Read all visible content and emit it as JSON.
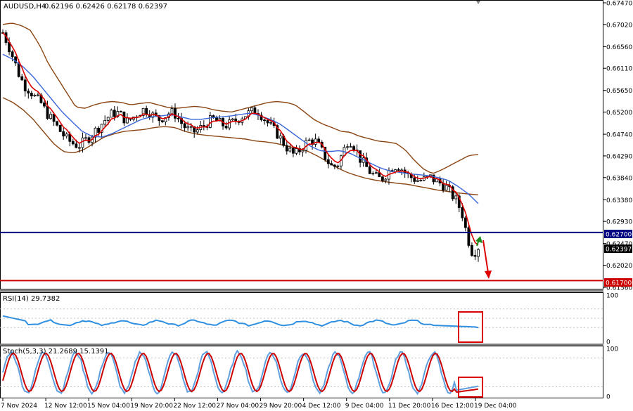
{
  "colors": {
    "background": "#ffffff",
    "frame": "#000000",
    "grid": "#c0c0c0",
    "bullish_candle": "#000000",
    "bearish_candle": "#000000",
    "bollinger": "#8b4513",
    "ma_fast": "#dd0000",
    "ma_slow": "#3a66d8",
    "rsi_line": "#2f8fe0",
    "stoch_main": "#5f9fe0",
    "stoch_signal": "#cc0000",
    "resistance_line": "#000080",
    "support_line": "#cc0000",
    "up_arrow": "#1b8a1b",
    "down_arrow": "#dd0000",
    "highlight_box": "#dd0000",
    "panel_separator": "#808080"
  },
  "header": {
    "title": "AUDUSD,H4",
    "ohlc": "0.62196 0.62426 0.62178 0.62397",
    "rsi_label": "RSI(14) 29.7382",
    "stoch_label": "Stoch(5,3,3) 21.2689 15.1391"
  },
  "levels": {
    "resistance": {
      "value": 0.627,
      "label": "0.62700"
    },
    "support": {
      "value": 0.617,
      "label": "0.61700"
    },
    "current": {
      "value": 0.62397,
      "label": "0.62397"
    }
  },
  "chart_data": {
    "type": "candlestick",
    "title": "AUDUSD,H4",
    "xlabel": "",
    "ylabel": "",
    "ylim": [
      0.6156,
      0.6747
    ],
    "y_ticks": [
      "0.67470",
      "0.67020",
      "0.66560",
      "0.66110",
      "0.65650",
      "0.65200",
      "0.64740",
      "0.64290",
      "0.63840",
      "0.63380",
      "0.62930",
      "0.62470",
      "0.62020",
      "0.61560"
    ],
    "x_ticks": [
      "7 Nov 2024",
      "12 Nov 12:00",
      "15 Nov 04:00",
      "19 Nov 20:00",
      "22 Nov 12:00",
      "27 Nov 04:00",
      "29 Nov 20:00",
      "4 Dec 12:00",
      "9 Dec 04:00",
      "11 Dec 20:00",
      "16 Dec 12:00",
      "19 Dec 04:00"
    ],
    "close_path": [
      0.6685,
      0.666,
      0.663,
      0.6598,
      0.6575,
      0.6565,
      0.655,
      0.654,
      0.652,
      0.6505,
      0.649,
      0.6475,
      0.6462,
      0.6455,
      0.645,
      0.6458,
      0.6468,
      0.648,
      0.6492,
      0.6505,
      0.6515,
      0.652,
      0.6512,
      0.65,
      0.6508,
      0.6518,
      0.6525,
      0.6522,
      0.651,
      0.6505,
      0.6512,
      0.652,
      0.6515,
      0.6498,
      0.6485,
      0.6478,
      0.6482,
      0.649,
      0.65,
      0.6505,
      0.6498,
      0.6492,
      0.6495,
      0.6502,
      0.651,
      0.6515,
      0.652,
      0.6525,
      0.6512,
      0.6498,
      0.6485,
      0.6472,
      0.6455,
      0.644,
      0.643,
      0.6442,
      0.6455,
      0.6462,
      0.6458,
      0.644,
      0.642,
      0.6405,
      0.6412,
      0.6438,
      0.6465,
      0.645,
      0.6425,
      0.641,
      0.6395,
      0.6385,
      0.638,
      0.6392,
      0.6405,
      0.641,
      0.64,
      0.6388,
      0.6382,
      0.6378,
      0.638,
      0.6385,
      0.6378,
      0.6372,
      0.6365,
      0.635,
      0.6335,
      0.631,
      0.626,
      0.6225,
      0.624
    ],
    "bollinger_upper_path": [
      0.6702,
      0.6705,
      0.67,
      0.669,
      0.666,
      0.662,
      0.659,
      0.656,
      0.653,
      0.6528,
      0.6535,
      0.654,
      0.6542,
      0.654,
      0.6535,
      0.6538,
      0.654,
      0.6535,
      0.653,
      0.6528,
      0.653,
      0.6532,
      0.653,
      0.6525,
      0.6522,
      0.652,
      0.6525,
      0.653,
      0.6535,
      0.654,
      0.6542,
      0.654,
      0.6535,
      0.652,
      0.6505,
      0.6495,
      0.6488,
      0.648,
      0.6478,
      0.647,
      0.6465,
      0.646,
      0.6458,
      0.6455,
      0.6442,
      0.642,
      0.6402,
      0.6392,
      0.64,
      0.641,
      0.642,
      0.643,
      0.6432
    ],
    "bollinger_lower_path": [
      0.655,
      0.654,
      0.6525,
      0.6505,
      0.648,
      0.6455,
      0.6438,
      0.6435,
      0.6442,
      0.6455,
      0.6468,
      0.6475,
      0.648,
      0.6482,
      0.6484,
      0.6488,
      0.649,
      0.6488,
      0.648,
      0.6475,
      0.6472,
      0.647,
      0.6468,
      0.6466,
      0.6464,
      0.646,
      0.6458,
      0.6455,
      0.645,
      0.6445,
      0.644,
      0.643,
      0.6418,
      0.6405,
      0.6395,
      0.6388,
      0.6382,
      0.6378,
      0.6375,
      0.6372,
      0.637,
      0.6366,
      0.6362,
      0.6358,
      0.6355,
      0.6352,
      0.635,
      0.6348
    ],
    "ma_slow_path": [
      0.664,
      0.663,
      0.6615,
      0.6595,
      0.657,
      0.6545,
      0.652,
      0.65,
      0.648,
      0.647,
      0.6468,
      0.6475,
      0.6485,
      0.6495,
      0.6505,
      0.651,
      0.6512,
      0.6515,
      0.651,
      0.6505,
      0.6505,
      0.6508,
      0.651,
      0.6512,
      0.6515,
      0.6518,
      0.6512,
      0.6505,
      0.6495,
      0.648,
      0.6465,
      0.645,
      0.644,
      0.6438,
      0.644,
      0.6435,
      0.6425,
      0.6415,
      0.6405,
      0.6398,
      0.6395,
      0.6392,
      0.639,
      0.6388,
      0.6384,
      0.6378,
      0.6365,
      0.635,
      0.633
    ],
    "rsi": {
      "current": 29.7382,
      "levels": [
        70,
        50,
        30
      ],
      "ylim": [
        0,
        100
      ]
    },
    "stochastic": {
      "main": 21.2689,
      "signal": 15.1391,
      "levels": [
        80,
        20
      ],
      "ylim": [
        0,
        100
      ]
    }
  },
  "annotations": {
    "up_arrow": "green-up-arrow",
    "down_arrow": "red-down-arrow",
    "rsi_box": "rsi-oversold-highlight",
    "stoch_box": "stoch-oversold-highlight"
  }
}
